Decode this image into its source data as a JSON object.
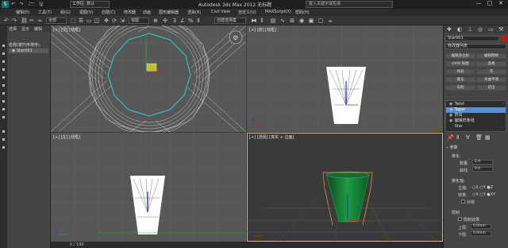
{
  "titlebar": {
    "workspace": "工作区: 默认",
    "title": "Autodesk 3ds Max 2012    无标题",
    "search_placeholder": "键入关键字或短语",
    "qat_icons": [
      "new-icon",
      "open-icon",
      "save-icon",
      "undo-icon",
      "redo-icon"
    ],
    "window_controls": [
      "—",
      "□",
      "✕"
    ]
  },
  "menubar": {
    "items": [
      "编辑(E)",
      "工具(T)",
      "组(G)",
      "视图(V)",
      "创建(C)",
      "修改器",
      "动画",
      "图形编辑器",
      "渲染(R)",
      "Civil View",
      "自定义(U)",
      "MAXScript(X)",
      "帮助(H)"
    ]
  },
  "toolbar": {
    "filter_value": "全部",
    "view_value": "视图",
    "selection_set": "创建选择集"
  },
  "scene_explorer": {
    "tabs": [
      "选择",
      "显示",
      "编辑"
    ],
    "header": "名称(按升序排序)",
    "items": [
      "Star001"
    ]
  },
  "viewports": {
    "top_label": "[+] [顶] [线框]",
    "front_label": "[+] [前] [线框]",
    "left_label": "[+] [左] [线框]",
    "persp_label": "[+] [透视] [真实 + 边面]"
  },
  "timebar": {
    "frame": "0 / 100"
  },
  "command_panel": {
    "object_name": "Star001",
    "object_color": "#c01818",
    "modifier_list": "修改器列表",
    "buttons": [
      "编辑多边形",
      "编辑网格",
      "UVW 贴图",
      "晶格",
      "倾斜",
      "壳",
      "锥化",
      "弯曲平滑",
      "车削",
      "挤出"
    ],
    "stack": [
      {
        "label": "Twist",
        "selected": false
      },
      {
        "label": "Taper",
        "selected": true
      },
      {
        "label": "挤出",
        "selected": false
      },
      {
        "label": "编辑样条线",
        "selected": false
      },
      {
        "label": "Star",
        "selected": false
      }
    ],
    "params": {
      "rollout": "参数",
      "twist_group": "锥化:",
      "amount_label": "数量:",
      "amount_value": "2.9",
      "curve_label": "曲线:",
      "curve_value": "0.0",
      "axis_group": "锥化轴:",
      "primary_label": "主轴:",
      "effect_label": "效果:",
      "symmetric_label": "对称",
      "limits_group": "限制",
      "limit_effect_label": "限制效果",
      "upper_label": "上限:",
      "upper_value": "0.0mm",
      "lower_label": "下限:",
      "lower_value": "0.0mm"
    }
  }
}
